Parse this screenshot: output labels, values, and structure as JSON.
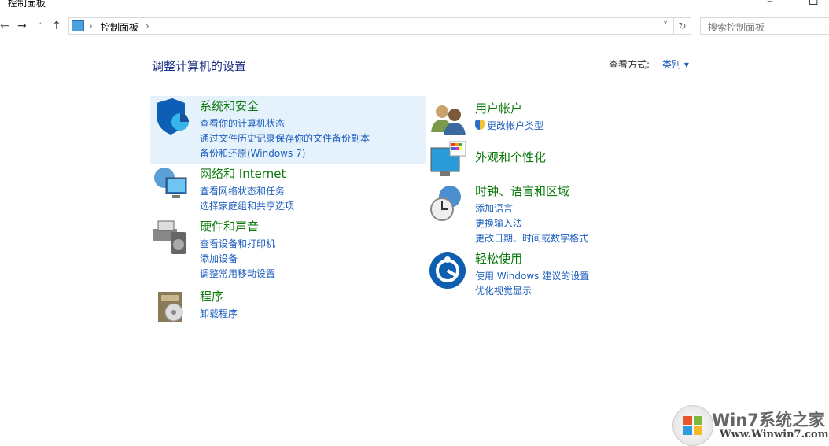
{
  "window": {
    "title": "控制面板",
    "minimize": "–",
    "maximize": "☐"
  },
  "nav": {
    "back": "←",
    "forward": "→",
    "recent": "˅",
    "up": "↑"
  },
  "address": {
    "crumb": "控制面板",
    "sep": "›",
    "dropdown": "˅",
    "refresh": "↻"
  },
  "search": {
    "placeholder": "搜索控制面板"
  },
  "main": {
    "heading": "调整计算机的设置",
    "view_label": "查看方式:",
    "view_value": "类别 ▾"
  },
  "left": [
    {
      "title": "系统和安全",
      "links": [
        "查看你的计算机状态",
        "通过文件历史记录保存你的文件备份副本",
        "备份和还原(Windows 7)"
      ]
    },
    {
      "title": "网络和 Internet",
      "links": [
        "查看网络状态和任务",
        "选择家庭组和共享选项"
      ]
    },
    {
      "title": "硬件和声音",
      "links": [
        "查看设备和打印机",
        "添加设备",
        "调整常用移动设置"
      ]
    },
    {
      "title": "程序",
      "links": [
        "卸载程序"
      ]
    }
  ],
  "right": [
    {
      "title": "用户帐户",
      "links": [
        "更改帐户类型"
      ]
    },
    {
      "title": "外观和个性化",
      "links": []
    },
    {
      "title": "时钟、语言和区域",
      "links": [
        "添加语言",
        "更换输入法",
        "更改日期、时间或数字格式"
      ]
    },
    {
      "title": "轻松使用",
      "links": [
        "使用 Windows 建议的设置",
        "优化视觉显示"
      ]
    }
  ],
  "watermark": {
    "brand": "Win7系统之家",
    "url": "Www.Winwin7.com"
  }
}
